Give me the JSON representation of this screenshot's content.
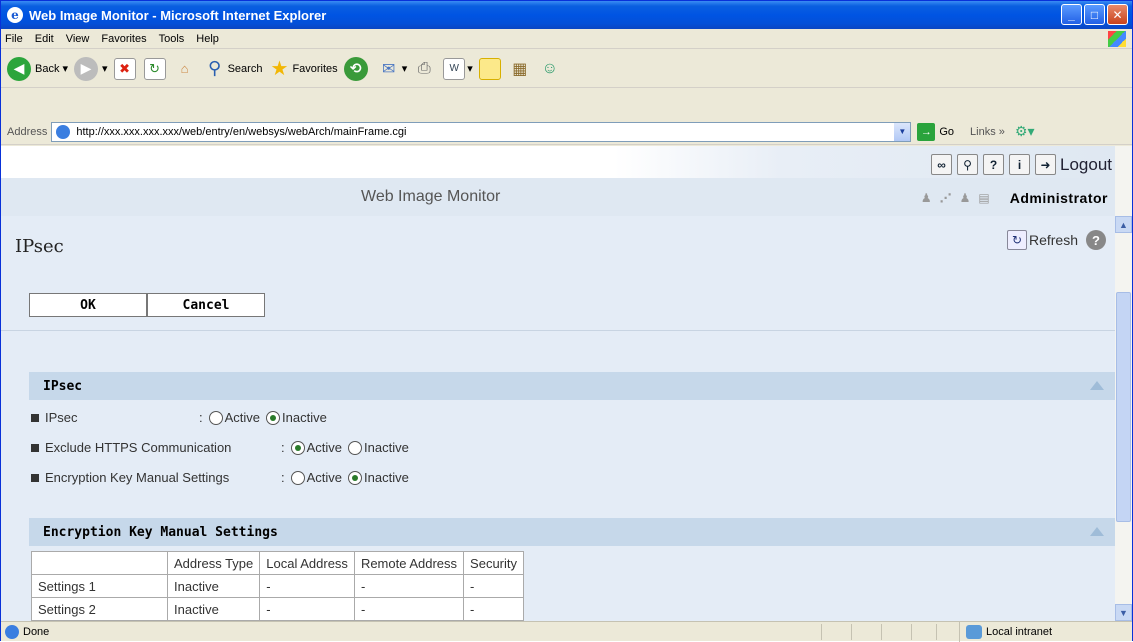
{
  "window": {
    "title": "Web Image Monitor - Microsoft Internet Explorer"
  },
  "menu": [
    "File",
    "Edit",
    "View",
    "Favorites",
    "Tools",
    "Help"
  ],
  "toolbar": {
    "back": "Back",
    "search": "Search",
    "favorites": "Favorites"
  },
  "address": {
    "label": "Address",
    "url": "http://xxx.xxx.xxx.xxx/web/entry/en/websys/webArch/mainFrame.cgi",
    "go": "Go",
    "links": "Links"
  },
  "header": {
    "app_title": "Web Image Monitor",
    "logout": "Logout",
    "user": "Administrator"
  },
  "page": {
    "title": "IPsec",
    "refresh": "Refresh"
  },
  "buttons": {
    "ok": "OK",
    "cancel": "Cancel"
  },
  "section1": {
    "title": "IPsec",
    "rows": [
      {
        "label": "IPsec",
        "active": "Active",
        "inactive": "Inactive",
        "selected": "inactive"
      },
      {
        "label": "Exclude HTTPS Communication",
        "active": "Active",
        "inactive": "Inactive",
        "selected": "active"
      },
      {
        "label": "Encryption Key Manual Settings",
        "active": "Active",
        "inactive": "Inactive",
        "selected": "inactive"
      }
    ]
  },
  "section2": {
    "title": "Encryption Key Manual Settings",
    "columns": [
      "",
      "Address Type",
      "Local Address",
      "Remote Address",
      "Security"
    ],
    "rows": [
      [
        "Settings 1",
        "Inactive",
        "-",
        "-",
        "-"
      ],
      [
        "Settings 2",
        "Inactive",
        "-",
        "-",
        "-"
      ]
    ]
  },
  "status": {
    "text": "Done",
    "zone": "Local intranet"
  }
}
